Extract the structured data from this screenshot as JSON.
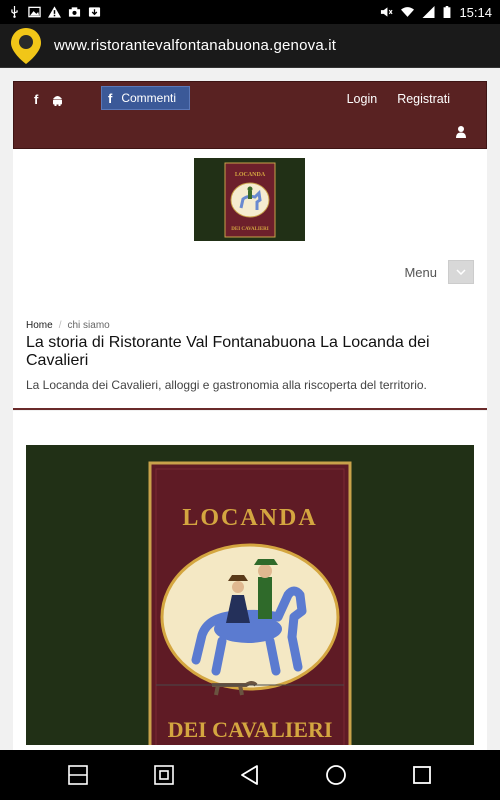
{
  "status_bar": {
    "time": "15:14",
    "left_icons": [
      "usb-icon",
      "image-icon",
      "warning-icon",
      "camera-icon",
      "download-icon"
    ],
    "right_icons": [
      "mute-icon",
      "wifi-icon",
      "signal-icon",
      "battery-icon"
    ]
  },
  "address_bar": {
    "url": "www.ristorantevalfontanabuona.genova.it",
    "icon": "location-pin-icon"
  },
  "top_bar": {
    "social": [
      "facebook-icon",
      "android-icon"
    ],
    "comments_button": "Commenti",
    "login": "Login",
    "register": "Registrati",
    "user_icon": "user-icon"
  },
  "header": {
    "logo_top": "LOCANDA",
    "logo_bottom": "DEI CAVALIERI",
    "menu_label": "Menu"
  },
  "breadcrumb": {
    "home": "Home",
    "current": "chi siamo"
  },
  "article": {
    "title": "La storia di Ristorante Val Fontanabuona La Locanda dei Cavalieri",
    "subtitle": "La Locanda dei Cavalieri, alloggi e gastronomia alla riscoperta del territorio.",
    "sign_top": "LOCANDA",
    "sign_bottom": "DEI CAVALIERI"
  },
  "nav_bar": {
    "icons": [
      "split-screen-icon",
      "screenshot-icon",
      "back-icon",
      "home-icon",
      "recents-icon"
    ]
  },
  "colors": {
    "brand_maroon": "#592222",
    "facebook_blue": "#3b5998",
    "sign_green": "#213016",
    "sign_red": "#6d1f2b",
    "gold": "#d4a640"
  }
}
